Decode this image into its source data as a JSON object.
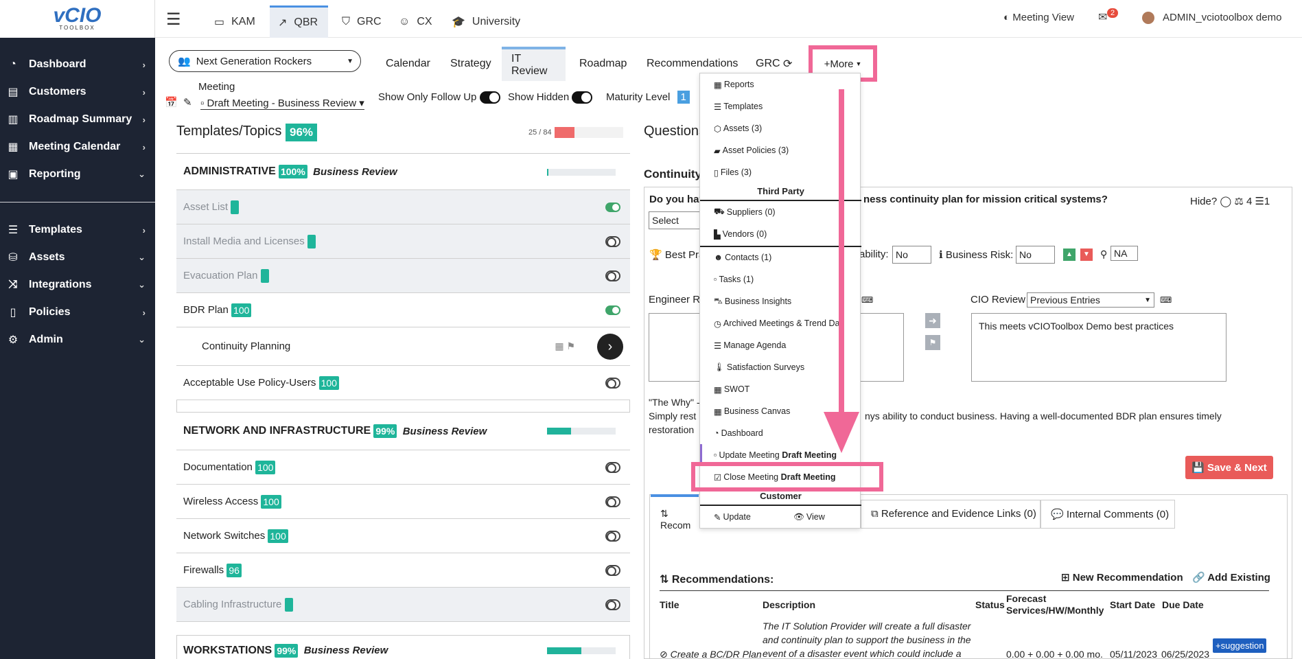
{
  "brand": {
    "logo": "vCIO",
    "logo_sub": "TOOLBOX"
  },
  "sidebar": {
    "items": [
      {
        "label": "Dashboard",
        "icon": "dashboard-icon",
        "chev": "›"
      },
      {
        "label": "Customers",
        "icon": "customers-icon",
        "chev": "›"
      },
      {
        "label": "Roadmap Summary",
        "icon": "map-icon",
        "chev": "›"
      },
      {
        "label": "Meeting Calendar",
        "icon": "calendar-icon",
        "chev": "›"
      },
      {
        "label": "Reporting",
        "icon": "reporting-icon",
        "chev": "⌄"
      },
      {
        "label": "Templates",
        "icon": "templates-icon",
        "chev": "›"
      },
      {
        "label": "Assets",
        "icon": "assets-icon",
        "chev": "⌄"
      },
      {
        "label": "Integrations",
        "icon": "integrations-icon",
        "chev": "⌄"
      },
      {
        "label": "Policies",
        "icon": "policies-icon",
        "chev": "›"
      },
      {
        "label": "Admin",
        "icon": "admin-icon",
        "chev": "⌄"
      }
    ]
  },
  "topnav": {
    "tabs": [
      {
        "label": "KAM",
        "icon": "id-card-icon"
      },
      {
        "label": "QBR",
        "icon": "chart-line-icon"
      },
      {
        "label": "GRC",
        "icon": "shield-icon"
      },
      {
        "label": "CX",
        "icon": "smile-icon"
      },
      {
        "label": "University",
        "icon": "graduation-cap-icon"
      }
    ],
    "meeting_view": "Meeting View",
    "mail_count": "2",
    "user": "ADMIN_vciotoolbox demo"
  },
  "customer_select": "Next Generation Rockers",
  "subtabs": [
    "Calendar",
    "Strategy",
    "IT Review",
    "Roadmap",
    "Recommendations",
    "GRC",
    "+More"
  ],
  "meeting": {
    "label": "Meeting",
    "value": "Draft Meeting - Business Review",
    "follow_up": "Show Only Follow Up",
    "show_hidden": "Show Hidden",
    "maturity": "Maturity Level",
    "maturity_value": "1"
  },
  "left": {
    "title": "Templates/Topics",
    "pct": "96%",
    "count": "25 / 84",
    "sections": [
      {
        "name": "ADMINISTRATIVE",
        "pct": "100%",
        "type": "Business Review",
        "progress": 0.02
      },
      {
        "name": "NETWORK AND INFRASTRUCTURE",
        "pct": "99%",
        "type": "Business Review",
        "progress": 0.35
      },
      {
        "name": "WORKSTATIONS",
        "pct": "99%",
        "type": "Business Review",
        "progress": 0.5
      }
    ],
    "rows": [
      {
        "label": "Asset List",
        "badge": ""
      },
      {
        "label": "Install Media and Licenses",
        "badge": ""
      },
      {
        "label": "Evacuation Plan",
        "badge": ""
      },
      {
        "label": "BDR Plan",
        "badge": "100"
      },
      {
        "label": "Continuity Planning",
        "badge": ""
      },
      {
        "label": "Acceptable Use Policy-Users",
        "badge": "100"
      },
      {
        "label": "Documentation",
        "badge": "100"
      },
      {
        "label": "Wireless Access",
        "badge": "100"
      },
      {
        "label": "Network Switches",
        "badge": "100"
      },
      {
        "label": "Firewalls",
        "badge": "96"
      },
      {
        "label": "Cabling Infrastructure",
        "badge": ""
      }
    ]
  },
  "right": {
    "questions_title": "Questions",
    "continuity": "Continuity",
    "question_a": "Do you hav",
    "question_b": "ness continuity plan for mission critical systems?",
    "hide": "Hide?",
    "scale_count": "4",
    "list_count": "1",
    "select": "Select",
    "best_practice": "Best Prac",
    "ability": "ability:",
    "ability_value": "No",
    "business_risk": "Business Risk:",
    "risk_value": "No",
    "na_value": "NA",
    "engineer_review": "Engineer Re",
    "cio_review": "CIO Review",
    "cio_select": "Previous Entries",
    "cio_text": "This meets vCIOToolbox Demo best practices",
    "why_title": "\"The Why\" -",
    "why_1a": "Simply rest",
    "why_1b": "nys ability to conduct business. Having a well-documented BDR plan ensures timely",
    "why_2": "restoration",
    "save_next": "Save & Next",
    "tabs": [
      "Recom",
      "Reference and Evidence Links (0)",
      "Internal Comments (0)"
    ],
    "recommendations_title": "Recommendations:",
    "new_rec": "New Recommendation",
    "add_existing": "Add Existing",
    "columns": [
      "Title",
      "Description",
      "Status",
      "Forecast Services/HW/Monthly",
      "Start Date",
      "Due Date"
    ],
    "row": {
      "title": "Create a BC/DR Plan",
      "desc1": "The IT Solution Provider will create a full disaster",
      "desc2": "and continuity plan to support the business in the",
      "desc3": "event of a disaster event which could include a",
      "forecast": "0.00 + 0.00 + 0.00 mo.",
      "start": "05/11/2023",
      "due": "06/25/2023",
      "suggestion": "+suggestion"
    }
  },
  "dropdown": {
    "items": [
      "Reports",
      "Templates",
      "Assets (3)",
      "Asset Policies (3)",
      "Files (3)"
    ],
    "third_party": "Third Party",
    "tp_items": [
      "Suppliers (0)",
      "Vendors (0)"
    ],
    "more_items": [
      "Contacts (1)",
      "Tasks (1)",
      "Business Insights",
      "Archived Meetings & Trend Dat",
      "Manage Agenda",
      "Satisfaction Surveys",
      "SWOT",
      "Business Canvas",
      "Dashboard"
    ],
    "update_meeting": "Update Meeting",
    "close_meeting": "Close Meeting",
    "draft": "Draft Meeting",
    "customer": "Customer",
    "update": "Update",
    "view": "View"
  },
  "colors": {
    "sidebar": "#1d2433",
    "accent": "#f06897",
    "badge": "#1fb59a",
    "button": "#e95b59"
  }
}
